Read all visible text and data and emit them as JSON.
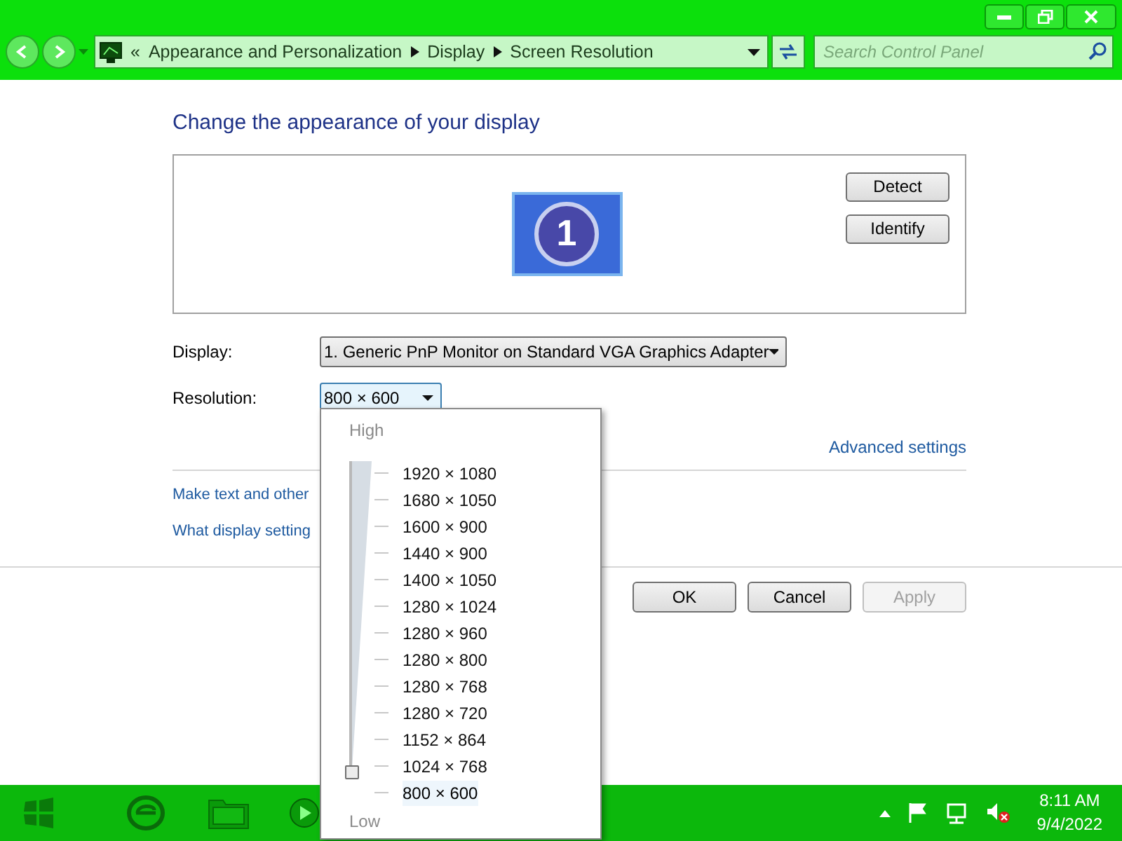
{
  "address_bar": {
    "breadcrumb": [
      "Appearance and Personalization",
      "Display",
      "Screen Resolution"
    ],
    "overflow": "«"
  },
  "search": {
    "placeholder": "Search Control Panel"
  },
  "heading": "Change the appearance of your display",
  "monitor": {
    "number": "1"
  },
  "monitor_buttons": [
    "Detect",
    "Identify"
  ],
  "display": {
    "label": "Display:",
    "value": "1. Generic PnP Monitor on Standard VGA Graphics Adapter"
  },
  "resolution": {
    "label": "Resolution:",
    "value": "800 × 600",
    "expanded": true
  },
  "advanced_link": "Advanced settings",
  "links": [
    "Make text and other",
    "What display setting"
  ],
  "buttons": [
    {
      "label": "OK",
      "disabled": false
    },
    {
      "label": "Cancel",
      "disabled": false
    },
    {
      "label": "Apply",
      "disabled": true
    }
  ],
  "popup": {
    "high": "High",
    "low": "Low",
    "level": 0,
    "options": [
      {
        "label": "1920 × 1080",
        "selected": false
      },
      {
        "label": "1680 × 1050",
        "selected": false
      },
      {
        "label": "1600 × 900",
        "selected": false
      },
      {
        "label": "1440 × 900",
        "selected": false
      },
      {
        "label": "1400 × 1050",
        "selected": false
      },
      {
        "label": "1280 × 1024",
        "selected": false
      },
      {
        "label": "1280 × 960",
        "selected": false
      },
      {
        "label": "1280 × 800",
        "selected": false
      },
      {
        "label": "1280 × 768",
        "selected": false
      },
      {
        "label": "1280 × 720",
        "selected": false
      },
      {
        "label": "1152 × 864",
        "selected": false
      },
      {
        "label": "1024 × 768",
        "selected": false
      },
      {
        "label": "800 × 600",
        "selected": true
      }
    ]
  },
  "clock": {
    "time": "8:11 AM",
    "date": "9/4/2022"
  }
}
